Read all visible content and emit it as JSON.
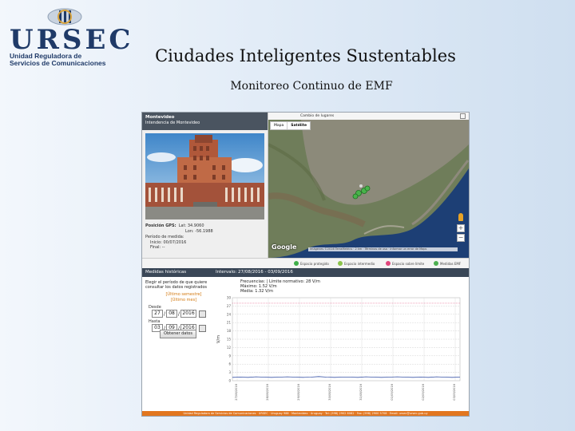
{
  "logo": {
    "name": "URSEC",
    "subtitle_lines": [
      "Unidad Reguladora de",
      "Servicios de Comunicaciones"
    ]
  },
  "slide": {
    "title": "Ciudades Inteligentes Sustentables",
    "subtitle": "Monitoreo Continuo de EMF"
  },
  "site_panel": {
    "name": "Montevideo",
    "org": "Intendencia de Montevideo",
    "gps_label": "Posición GPS:",
    "lat": "Lat: 34.9060",
    "lon": "Lon: -56.1988",
    "period_label": "Período de medida:",
    "start": "Inicio: 00/07/2016",
    "end": "Final: --"
  },
  "map": {
    "search_placeholder": "Cambio de lugares",
    "types": [
      "Mapa",
      "Satélite"
    ],
    "google": "Google",
    "footer_text": "Imágenes ©2016 TerraMetrics · 2 km · Términos de uso · Informar un error de Maps",
    "zoom_in": "+",
    "zoom_out": "−"
  },
  "legend": {
    "items": [
      {
        "label": "Espacio protegido",
        "color": "#3fae49"
      },
      {
        "label": "Espacio intermedio",
        "color": "#8bc34a"
      },
      {
        "label": "Espacio sobre límite",
        "color": "#e0457b"
      },
      {
        "label": "Medidas EMF",
        "color": "#4caf50"
      }
    ]
  },
  "history": {
    "header_left": "Medidas históricas",
    "header_right": "Intervalo: 27/08/2016 - 03/09/2016",
    "instructions": "Elegir el período de que quiere consultar los datos registrados",
    "orange_1": "[Último semestre]",
    "orange_2": "[Último mes]",
    "from_label": "Desde",
    "to_label": "Hasta",
    "from_day": "27",
    "from_month": "08",
    "from_year": "2016",
    "to_day": "03",
    "to_month": "09",
    "to_year": "2016",
    "button": "Obtener datos",
    "freq_line": "Frecuencias: | Límite normativo: 28 V/m",
    "max_line": "Máximo: 1.52 V/m",
    "avg_line": "Media: 1.32 V/m"
  },
  "chart_data": {
    "type": "line",
    "ylabel": "V/m",
    "ylim": [
      0,
      30
    ],
    "yticks": [
      "30",
      "27",
      "24",
      "21",
      "18",
      "15",
      "12",
      "9",
      "6",
      "3",
      "0"
    ],
    "xticks": [
      "27/08/2016",
      "28/08/2016",
      "29/08/2016",
      "30/08/2016",
      "31/08/2016",
      "01/09/2016",
      "02/09/2016",
      "03/09/2016"
    ],
    "series": [
      {
        "values": [
          1.2,
          1.3,
          1.2,
          1.4,
          1.3,
          1.2,
          1.3,
          1.4,
          1.3,
          1.2,
          1.3,
          1.5,
          1.3,
          1.2,
          1.3,
          1.3,
          1.2,
          1.4,
          1.3,
          1.2,
          1.3,
          1.4,
          1.3,
          1.2,
          1.3,
          1.2,
          1.4,
          1.3,
          1.2,
          1.3
        ]
      }
    ],
    "limit": 28,
    "colors": {
      "series": "#3a55a8",
      "limit": "#e0457b",
      "grid": "#d6d6d6"
    }
  },
  "footer": {
    "text": "Unidad Reguladora de Servicios de Comunicaciones · URSEC · Uruguay 988 · Montevideo · Uruguay · Tel: (598) 2902 8082 · Fax: (598) 2900 5708 · Email: ursec@ursec.gub.uy"
  }
}
